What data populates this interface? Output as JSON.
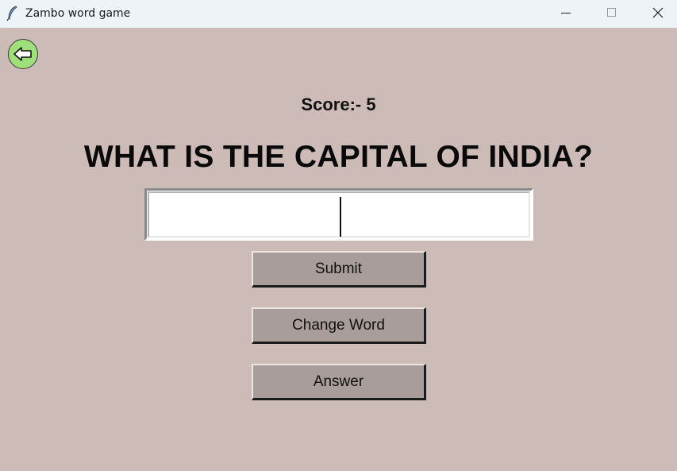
{
  "window": {
    "title": "Zambo word game",
    "icons": {
      "app": "feather-icon",
      "minimize": "minimize-icon",
      "maximize": "maximize-icon",
      "close": "close-icon"
    }
  },
  "back_button": {
    "icon": "arrow-left-icon",
    "color": "#9fe07a"
  },
  "score": {
    "label": "Score:- 5"
  },
  "question": {
    "text": "WHAT IS THE CAPITAL OF INDIA?"
  },
  "answer_field": {
    "value": "",
    "placeholder": ""
  },
  "buttons": {
    "submit": "Submit",
    "change_word": "Change Word",
    "answer": "Answer"
  },
  "colors": {
    "background": "#cdbbb8",
    "button": "#a89d9b",
    "titlebar": "#eef3f8"
  }
}
